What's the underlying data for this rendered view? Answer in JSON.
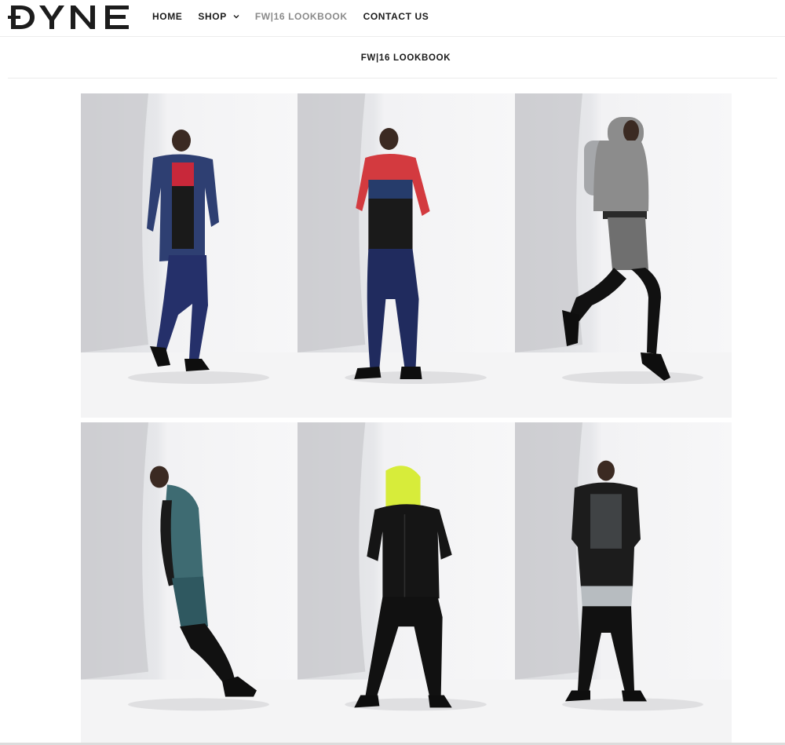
{
  "brand": {
    "logo_text": "ÐYNE",
    "color": "#1c1c1c"
  },
  "nav": {
    "items": [
      {
        "label": "HOME",
        "active": false
      },
      {
        "label": "SHOP",
        "active": false,
        "has_dropdown": true
      },
      {
        "label": "FW|16 LOOKBOOK",
        "active": true
      },
      {
        "label": "CONTACT US",
        "active": false
      }
    ]
  },
  "page": {
    "title": "FW|16 LOOKBOOK"
  },
  "lookbook": {
    "images": [
      {
        "name": "look-1",
        "jacket": "#2e3f72",
        "top": "#1a1a1a",
        "stripe": "#c8283a",
        "pants": "#25306a",
        "pose": "stand-left"
      },
      {
        "name": "look-2",
        "jacket": "#d33a3f",
        "top": "#1a1a1a",
        "stripe": "#263c6b",
        "pants": "#202b5e",
        "pose": "stand"
      },
      {
        "name": "look-3",
        "jacket": "#8c8c8c",
        "top": "#2a2a2a",
        "stripe": "#6f6f6f",
        "pants": "#111111",
        "pose": "jump"
      },
      {
        "name": "look-4",
        "jacket": "#3e6b72",
        "top": "#1a1a1a",
        "stripe": "#2f5860",
        "pants": "#111111",
        "pose": "lean"
      },
      {
        "name": "look-5",
        "jacket": "#151515",
        "top": "#151515",
        "stripe": "#d7ec3a",
        "pants": "#111111",
        "pose": "hood"
      },
      {
        "name": "look-6",
        "jacket": "#1c1c1c",
        "top": "#1c1c1c",
        "stripe": "#b7bcc0",
        "pants": "#111111",
        "pose": "back"
      }
    ]
  }
}
